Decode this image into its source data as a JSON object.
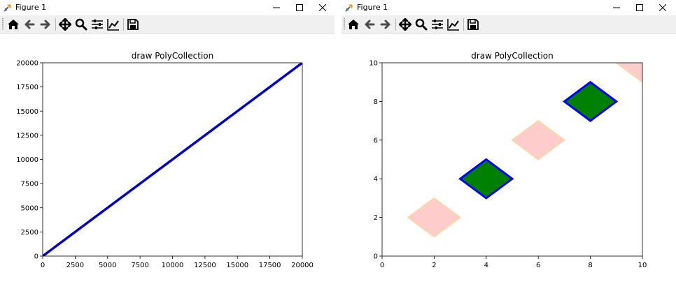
{
  "colors": {
    "line": "#0000cc",
    "green_fill": "#008000",
    "green_edge": "#0000ff",
    "pink_fill": "#ffcccc",
    "pink_edge": "#f7d8a8"
  },
  "windows": [
    {
      "title": "Figure 1",
      "toolbar_icons": [
        "home-icon",
        "back-icon",
        "forward-icon",
        "pan-icon",
        "zoom-icon",
        "configure-subplots-icon",
        "edit-axis-icon",
        "save-icon"
      ],
      "chart_data": {
        "type": "line",
        "title": "draw PolyCollection",
        "xlabel": "",
        "ylabel": "",
        "xlim": [
          0,
          20000
        ],
        "ylim": [
          0,
          20000
        ],
        "xticks": [
          0,
          2500,
          5000,
          7500,
          10000,
          12500,
          15000,
          17500,
          20000
        ],
        "yticks": [
          0,
          2500,
          5000,
          7500,
          10000,
          12500,
          15000,
          17500,
          20000
        ],
        "series": [
          {
            "x": [
              0,
              20000
            ],
            "y": [
              0,
              20000
            ],
            "color": "#0000cc"
          }
        ]
      }
    },
    {
      "title": "Figure 1",
      "toolbar_icons": [
        "home-icon",
        "back-icon",
        "forward-icon",
        "pan-icon",
        "zoom-icon",
        "configure-subplots-icon",
        "edit-axis-icon",
        "save-icon"
      ],
      "chart_data": {
        "type": "polygon",
        "title": "draw PolyCollection",
        "xlabel": "",
        "ylabel": "",
        "xlim": [
          0,
          10
        ],
        "ylim": [
          0,
          10
        ],
        "xticks": [
          0,
          2,
          4,
          6,
          8,
          10
        ],
        "yticks": [
          0,
          2,
          4,
          6,
          8,
          10
        ],
        "polygons": [
          {
            "center": [
              2,
              2
            ],
            "half_width": 1,
            "fill": "pink"
          },
          {
            "center": [
              4,
              4
            ],
            "half_width": 1,
            "fill": "green"
          },
          {
            "center": [
              6,
              6
            ],
            "half_width": 1,
            "fill": "pink"
          },
          {
            "center": [
              8,
              8
            ],
            "half_width": 1,
            "fill": "green"
          },
          {
            "center": [
              10,
              10
            ],
            "half_width": 1,
            "fill": "pink"
          }
        ]
      }
    }
  ]
}
